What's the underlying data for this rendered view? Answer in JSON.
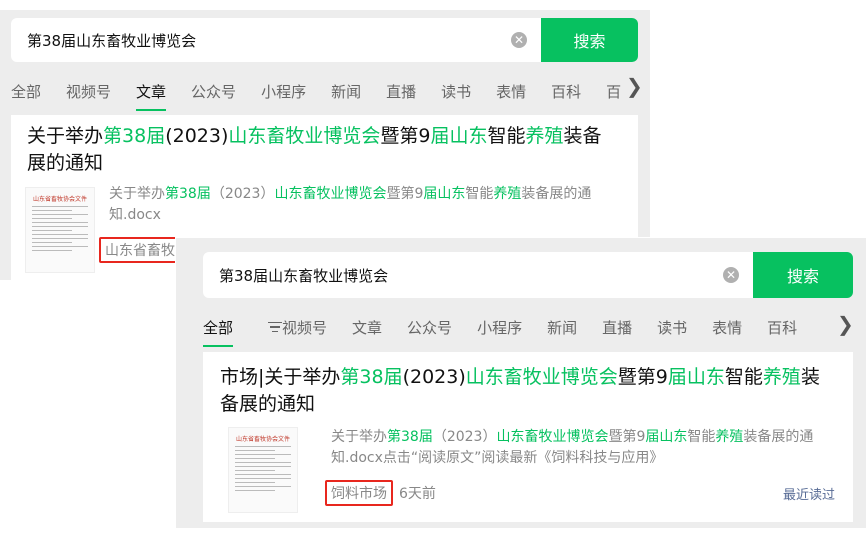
{
  "top": {
    "search": {
      "query": "第38届山东畜牧业博览会",
      "button_label": "搜索"
    },
    "tabs": [
      "全部",
      "视频号",
      "文章",
      "公众号",
      "小程序",
      "新闻",
      "直播",
      "读书",
      "表情",
      "百科",
      "百"
    ],
    "active_tab": "文章",
    "result": {
      "title": [
        {
          "t": "关于举办",
          "h": false
        },
        {
          "t": "第38届",
          "h": true
        },
        {
          "t": "(2023)",
          "h": false
        },
        {
          "t": "山东畜牧业博览会",
          "h": true
        },
        {
          "t": "暨第9",
          "h": false
        },
        {
          "t": "届山东",
          "h": true
        },
        {
          "t": "智能",
          "h": false
        },
        {
          "t": "养殖",
          "h": true
        },
        {
          "t": "装备展的通知",
          "h": false
        }
      ],
      "snippet": [
        {
          "t": "关于举办",
          "h": false
        },
        {
          "t": "第38届",
          "h": true
        },
        {
          "t": "（2023）",
          "h": false
        },
        {
          "t": "山东畜牧业博览会",
          "h": true
        },
        {
          "t": "暨第9",
          "h": false
        },
        {
          "t": "届山东",
          "h": true
        },
        {
          "t": "智能",
          "h": false
        },
        {
          "t": "养殖",
          "h": true
        },
        {
          "t": "装备展的通知.docx",
          "h": false
        }
      ],
      "source": "山东省畜牧",
      "thumb_header": "山东省畜牧协会文件"
    }
  },
  "bottom": {
    "search": {
      "query": "第38届山东畜牧业博览会",
      "button_label": "搜索"
    },
    "tabs": [
      "全部",
      "视频号",
      "文章",
      "公众号",
      "小程序",
      "新闻",
      "直播",
      "读书",
      "表情",
      "百科"
    ],
    "active_tab": "全部",
    "result": {
      "title": [
        {
          "t": "市场|关于举办",
          "h": false
        },
        {
          "t": "第38届",
          "h": true
        },
        {
          "t": "(2023)",
          "h": false
        },
        {
          "t": "山东畜牧业博览会",
          "h": true
        },
        {
          "t": "暨第9",
          "h": false
        },
        {
          "t": "届山东",
          "h": true
        },
        {
          "t": "智能",
          "h": false
        },
        {
          "t": "养殖",
          "h": true
        },
        {
          "t": "装备展的通知",
          "h": false
        }
      ],
      "snippet": [
        {
          "t": "关于举办",
          "h": false
        },
        {
          "t": "第38届",
          "h": true
        },
        {
          "t": "（2023）",
          "h": false
        },
        {
          "t": "山东畜牧业博览会",
          "h": true
        },
        {
          "t": "暨第9",
          "h": false
        },
        {
          "t": "届山东",
          "h": true
        },
        {
          "t": "智能",
          "h": false
        },
        {
          "t": "养殖",
          "h": true
        },
        {
          "t": "装备展的通知.docx点击“阅读原文”阅读最新《饲料科技与应用》",
          "h": false
        }
      ],
      "source": "饲料市场",
      "time": "6天前",
      "recent_label": "最近读过",
      "thumb_header": "山东省畜牧协会文件"
    }
  },
  "colors": {
    "accent": "#07c160",
    "highlight_box": "#e8271e",
    "link": "#576b95"
  }
}
